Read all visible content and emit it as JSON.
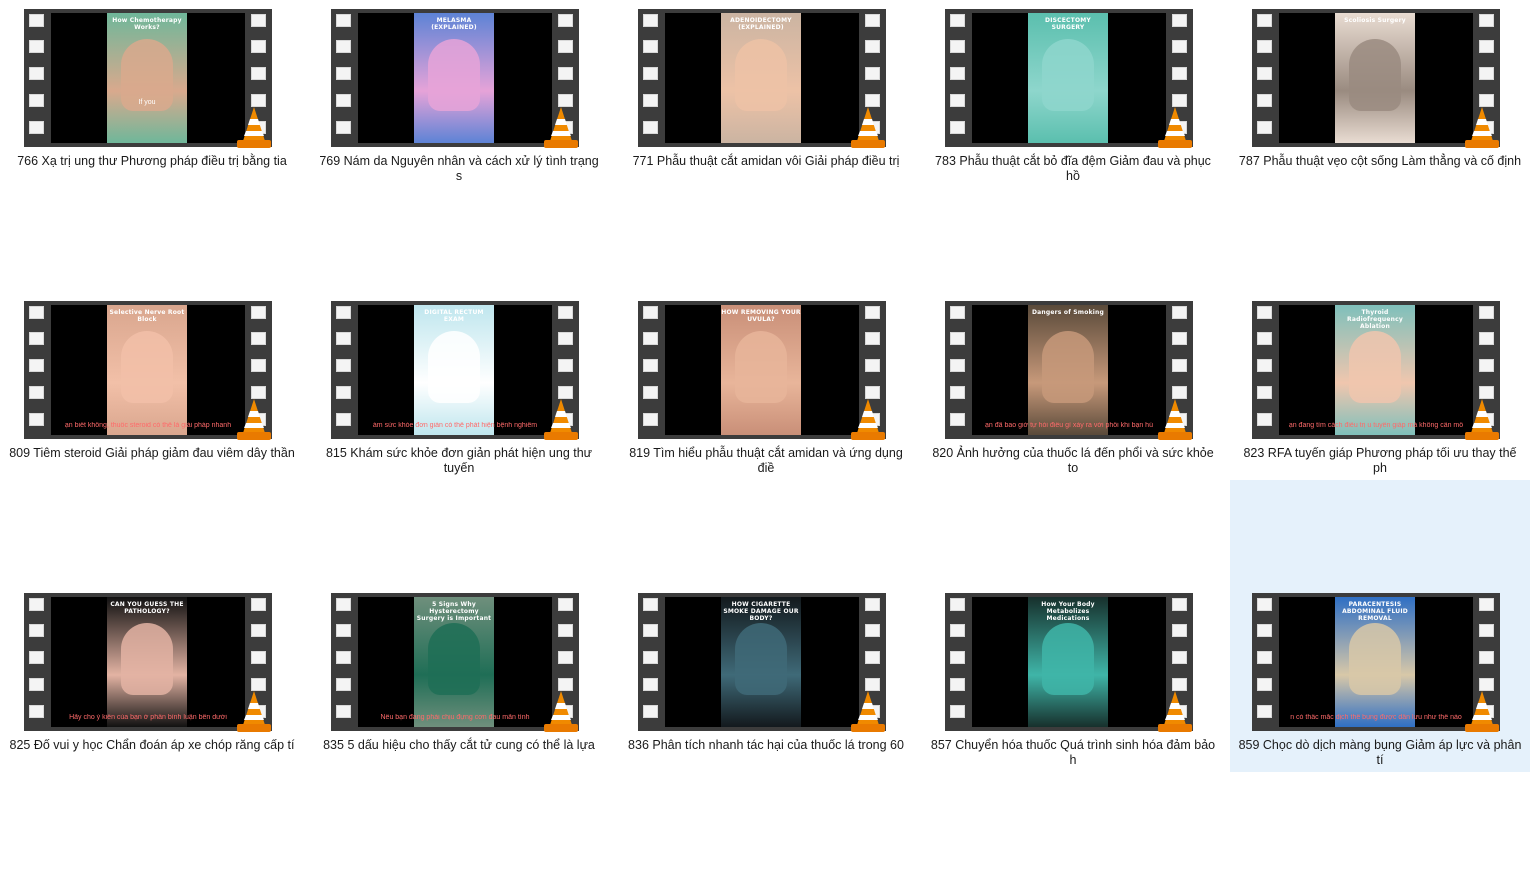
{
  "items": [
    {
      "id": "766",
      "caption": "766 Xạ trị ung thư Phương pháp điều trị bằng tia",
      "poster_title": "How Chemotherapy Works?",
      "poster_subtitle": "If you",
      "subtitle": "",
      "bg": "#6fb79a",
      "fg": "#d9a98d"
    },
    {
      "id": "769",
      "caption": "769 Nám da Nguyên nhân và cách xử lý tình trạng s",
      "poster_title": "MELASMA (EXPLAINED)",
      "poster_subtitle": "",
      "subtitle": "",
      "bg": "#5d83d6",
      "fg": "#e6a3d8"
    },
    {
      "id": "771",
      "caption": "771 Phẫu thuật cắt amidan vôi Giải pháp điều trị",
      "poster_title": "ADENOIDECTOMY (EXPLAINED)",
      "poster_subtitle": "",
      "subtitle": "",
      "bg": "#cbb4a2",
      "fg": "#edc2a6"
    },
    {
      "id": "783",
      "caption": "783 Phẫu thuật cắt bỏ đĩa đệm Giảm đau và phục hồ",
      "poster_title": "DISCECTOMY SURGERY",
      "poster_subtitle": "",
      "subtitle": "",
      "bg": "#5bbfae",
      "fg": "#8ed6cc"
    },
    {
      "id": "787",
      "caption": "787 Phẫu thuật vẹo cột sống Làm thẳng và cố định",
      "poster_title": "Scoliosis Surgery",
      "poster_subtitle": "",
      "subtitle": "",
      "bg": "#e9dcd2",
      "fg": "#9a8b80"
    },
    {
      "id": "809",
      "caption": "809 Tiêm steroid Giải pháp giảm đau viêm dây thần",
      "poster_title": "Selective Nerve Root Block",
      "poster_subtitle": "",
      "subtitle": "ạn biết không, thuốc steroid có thể là giải pháp nhanh",
      "bg": "#d9a68e",
      "fg": "#f2c0a8"
    },
    {
      "id": "815",
      "caption": "815 Khám sức khỏe đơn giản phát hiện ung thư tuyến",
      "poster_title": "DIGITAL RECTUM EXAM",
      "poster_subtitle": "",
      "subtitle": "ám sức khỏe đơn giản có thể phát hiện bệnh nghiêm",
      "bg": "#bfe6ee",
      "fg": "#ffffff"
    },
    {
      "id": "819",
      "caption": "819 Tìm hiểu phẫu thuật cắt amidan và ứng dụng điề",
      "poster_title": "HOW REMOVING YOUR UVULA?",
      "poster_subtitle": "",
      "subtitle": "",
      "bg": "#c98f78",
      "fg": "#e8b59a"
    },
    {
      "id": "820",
      "caption": "820 Ảnh hưởng của thuốc lá đến phổi và sức khỏe to",
      "poster_title": "Dangers of Smoking",
      "poster_subtitle": "",
      "subtitle": "ạn đã bao giờ tự hỏi điều gì xảy ra với phổi khi bạn hú",
      "bg": "#5a4a3a",
      "fg": "#c7997a"
    },
    {
      "id": "823",
      "caption": "823 RFA tuyến giáp Phương pháp tối ưu thay thế ph",
      "poster_title": "Thyroid Radiofrequency Ablation",
      "poster_subtitle": "",
      "subtitle": "ạn đang tìm cách điều trị u tuyến giáp mà không cần mổ",
      "bg": "#7fc0bb",
      "fg": "#f0c6ae"
    },
    {
      "id": "825",
      "caption": "825 Đố vui y học Chẩn đoán áp xe chóp răng cấp tí",
      "poster_title": "CAN YOU GUESS THE PATHOLOGY?",
      "poster_subtitle": "",
      "subtitle": "Hãy cho ý kiến của bạn ở phần bình luận bên dưới",
      "bg": "#111111",
      "fg": "#e3b3a3"
    },
    {
      "id": "835",
      "caption": "835 5 dấu hiệu cho thấy cắt tử cung có thể là lựa",
      "poster_title": "5 Signs Why Hysterectomy Surgery is Important",
      "poster_subtitle": "",
      "subtitle": "Nếu bạn đang phải chịu đựng cơn đau mãn tính",
      "bg": "#6f8f7c",
      "fg": "#1f6e56"
    },
    {
      "id": "836",
      "caption": "836 Phân tích nhanh tác hại của thuốc lá trong 60",
      "poster_title": "HOW CIGARETTE SMOKE DAMAGE OUR BODY?",
      "poster_subtitle": "",
      "subtitle": "",
      "bg": "#13191d",
      "fg": "#3f6a78"
    },
    {
      "id": "857",
      "caption": "857 Chuyển hóa thuốc Quá trình sinh hóa đảm bảo h",
      "poster_title": "How Your Body Metabolizes Medications",
      "poster_subtitle": "",
      "subtitle": "",
      "bg": "#17302c",
      "fg": "#3fb5a8"
    },
    {
      "id": "859",
      "caption": "859 Chọc dò dịch màng bụng Giảm áp lực và phân tí",
      "poster_title": "PARACENTESIS ABDOMINAL FLUID REMOVAL",
      "poster_subtitle": "",
      "subtitle": "n có thấc mắc dịch thể bụng được dẫn lưu như thế nào",
      "bg": "#2f6fc4",
      "fg": "#d8c8a8"
    }
  ],
  "selected_index": 14,
  "icons": {
    "cone": "vlc-cone-icon",
    "film": "film-strip-icon"
  },
  "colors": {
    "selection": "#e5f1fb",
    "film": "#3c3c3c",
    "subtitle": "#ff6a6a"
  }
}
